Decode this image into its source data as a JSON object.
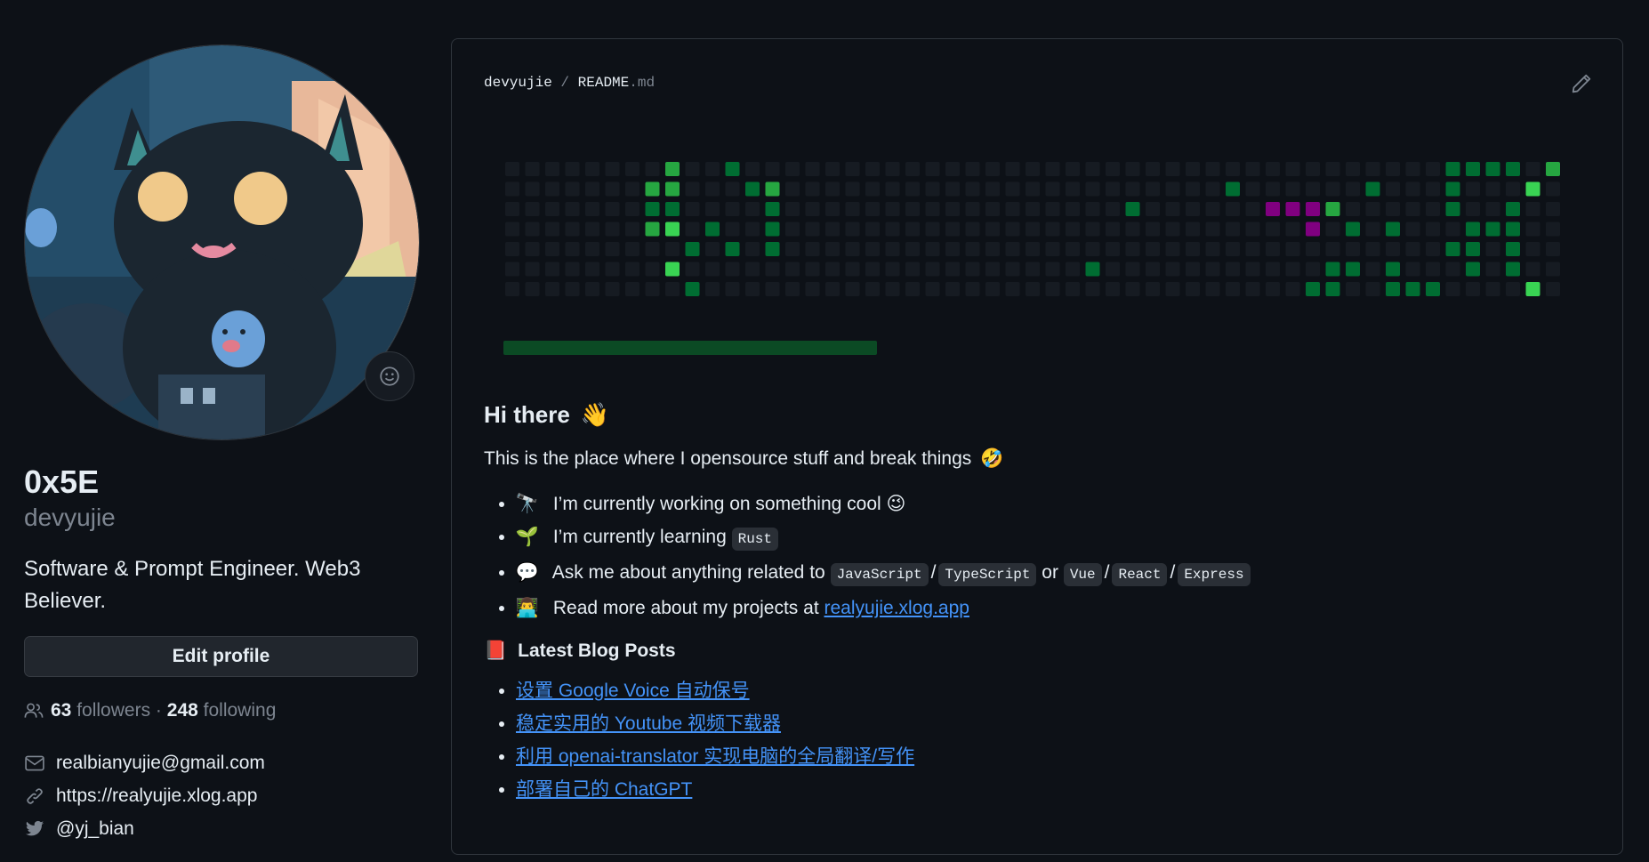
{
  "profile": {
    "fullname": "0x5E",
    "username": "devyujie",
    "bio": "Software & Prompt Engineer. Web3 Believer.",
    "edit_label": "Edit profile",
    "followers_count": "63",
    "followers_label": "followers",
    "separator": "·",
    "following_count": "248",
    "following_label": "following",
    "email": "realbianyujie@gmail.com",
    "website": "https://realyujie.xlog.app",
    "twitter": "@yj_bian"
  },
  "readme": {
    "owner": "devyujie",
    "slash": "/",
    "file_name": "README",
    "file_ext": ".md",
    "heading": "Hi there",
    "heading_emoji": "👋",
    "intro": "This is the place where I opensource stuff and break things",
    "intro_emoji": "🤣",
    "bullets": {
      "b1_emoji": "🔭",
      "b1_text": "I’m currently working on something cool",
      "b1_tail": "😉",
      "b2_emoji": "🌱",
      "b2_text": "I’m currently learning",
      "b2_code": "Rust",
      "b3_emoji": "💬",
      "b3_text": "Ask me about anything related to",
      "b3_code1": "JavaScript",
      "b3_code2": "TypeScript",
      "b3_or": "or",
      "b3_code3": "Vue",
      "b3_code4": "React",
      "b3_code5": "Express",
      "b4_emoji": "👨‍💻",
      "b4_text": "Read more about my projects at",
      "b4_link": "realyujie.xlog.app"
    },
    "blog_title": "Latest Blog Posts",
    "blog_emoji": "📕",
    "blog_posts": [
      "设置 Google Voice 自动保号",
      "稳定实用的 Youtube 视频下载器",
      "利用 openai-translator 实现电脑的全局翻译/写作",
      "部署自己的 ChatGPT"
    ]
  },
  "colors": {
    "background": "#0d1117",
    "link": "#4493f8",
    "graph_empty": "#161b22",
    "graph_l1": "#0e4429",
    "graph_l2": "#006d32",
    "graph_l3": "#26a641",
    "graph_l4": "#39d353",
    "snake": "#800080"
  },
  "contribution_graph": {
    "weeks": 53,
    "days": 7,
    "active_cells": [
      [
        8,
        0,
        3
      ],
      [
        11,
        0,
        2
      ],
      [
        47,
        0,
        2
      ],
      [
        48,
        0,
        2
      ],
      [
        49,
        0,
        2
      ],
      [
        50,
        0,
        2
      ],
      [
        52,
        0,
        3
      ],
      [
        7,
        1,
        3
      ],
      [
        8,
        1,
        3
      ],
      [
        12,
        1,
        2
      ],
      [
        13,
        1,
        3
      ],
      [
        36,
        1,
        2
      ],
      [
        43,
        1,
        2
      ],
      [
        47,
        1,
        2
      ],
      [
        51,
        1,
        4
      ],
      [
        7,
        2,
        2
      ],
      [
        8,
        2,
        2
      ],
      [
        13,
        2,
        2
      ],
      [
        31,
        2,
        2
      ],
      [
        41,
        2,
        3
      ],
      [
        47,
        2,
        2
      ],
      [
        50,
        2,
        2
      ],
      [
        7,
        3,
        3
      ],
      [
        8,
        3,
        4
      ],
      [
        10,
        3,
        2
      ],
      [
        13,
        3,
        2
      ],
      [
        42,
        3,
        2
      ],
      [
        44,
        3,
        2
      ],
      [
        48,
        3,
        2
      ],
      [
        49,
        3,
        2
      ],
      [
        50,
        3,
        2
      ],
      [
        9,
        4,
        2
      ],
      [
        11,
        4,
        2
      ],
      [
        13,
        4,
        2
      ],
      [
        47,
        4,
        2
      ],
      [
        48,
        4,
        2
      ],
      [
        50,
        4,
        2
      ],
      [
        8,
        5,
        4
      ],
      [
        29,
        5,
        2
      ],
      [
        41,
        5,
        2
      ],
      [
        42,
        5,
        2
      ],
      [
        44,
        5,
        2
      ],
      [
        48,
        5,
        2
      ],
      [
        50,
        5,
        2
      ],
      [
        9,
        6,
        2
      ],
      [
        40,
        6,
        2
      ],
      [
        41,
        6,
        2
      ],
      [
        44,
        6,
        2
      ],
      [
        45,
        6,
        2
      ],
      [
        46,
        6,
        2
      ],
      [
        51,
        6,
        4
      ]
    ],
    "snake_cells": [
      [
        38,
        2
      ],
      [
        39,
        2
      ],
      [
        40,
        2
      ],
      [
        40,
        3
      ]
    ]
  }
}
